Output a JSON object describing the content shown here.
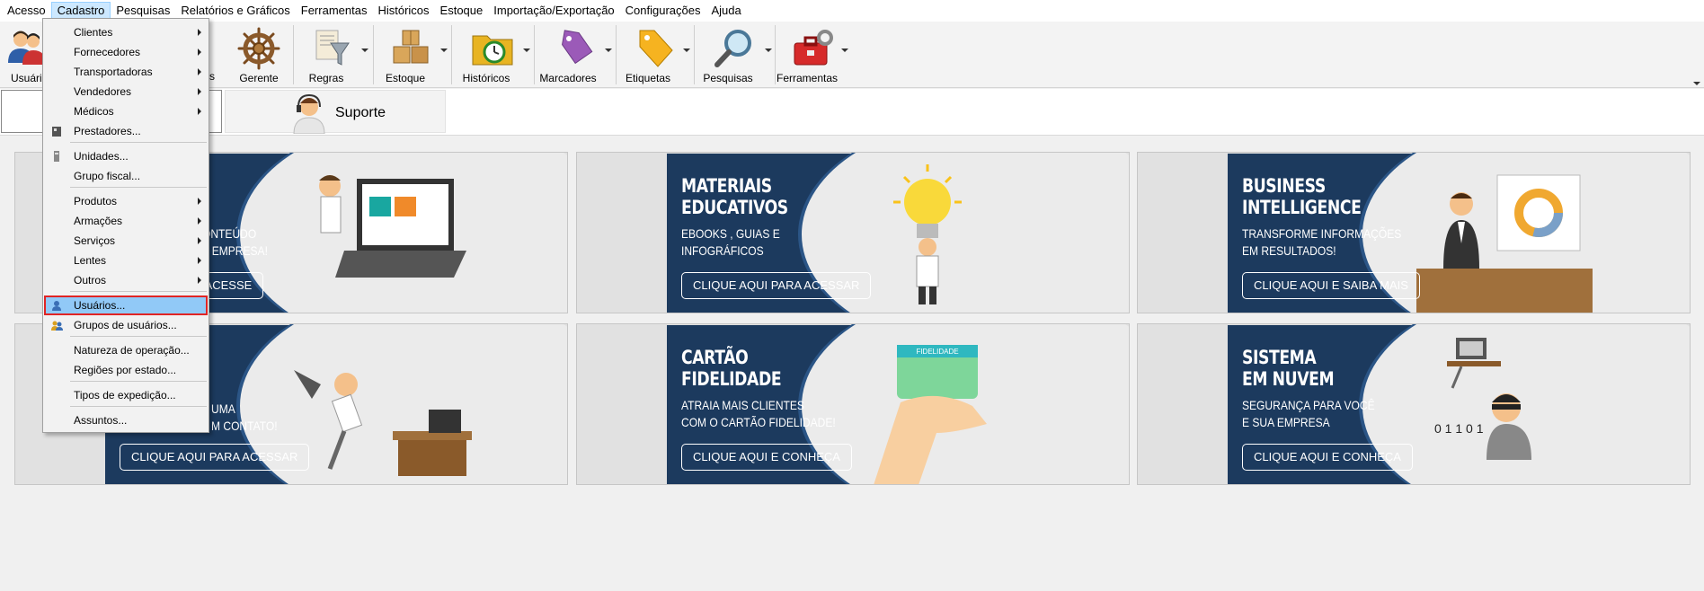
{
  "menubar": [
    "Acesso",
    "Cadastro",
    "Pesquisas",
    "Relatórios e Gráficos",
    "Ferramentas",
    "Históricos",
    "Estoque",
    "Importação/Exportação",
    "Configurações",
    "Ajuda"
  ],
  "toolbar": {
    "usuarios": "Usuári",
    "hidden_s": "s",
    "gerente": "Gerente",
    "regras": "Regras",
    "estoque": "Estoque",
    "historicos": "Históricos",
    "marcadores": "Marcadores",
    "etiquetas": "Etiquetas",
    "pesquisas": "Pesquisas",
    "ferramentas": "Ferramentas"
  },
  "tabs": {
    "suporte": "Suporte"
  },
  "cadastro_menu": {
    "clientes": "Clientes",
    "fornecedores": "Fornecedores",
    "transportadoras": "Transportadoras",
    "vendedores": "Vendedores",
    "medicos": "Médicos",
    "prestadores": "Prestadores...",
    "unidades": "Unidades...",
    "grupo_fiscal": "Grupo fiscal...",
    "produtos": "Produtos",
    "armacoes": "Armações",
    "servicos": "Serviços",
    "lentes": "Lentes",
    "outros": "Outros",
    "usuarios": "Usuários...",
    "grupos_usuarios": "Grupos de usuários...",
    "natureza": "Natureza de operação...",
    "regioes": "Regiões por estado...",
    "tipos_expedicao": "Tipos de expedição...",
    "assuntos": "Assuntos..."
  },
  "cards": {
    "c1": {
      "t2a": "ONTEÚDO",
      "t2b": "A EMPRESA!",
      "cta": "E ACESSE"
    },
    "c2": {
      "t1a": "MATERIAIS",
      "t1b": "EDUCATIVOS",
      "t2a": "EBOOKS , GUIAS E",
      "t2b": "INFOGRÁFICOS",
      "cta": "CLIQUE AQUI PARA ACESSAR"
    },
    "c3": {
      "t1a": "BUSINESS",
      "t1b": "INTELLIGENCE",
      "t2a": "TRANSFORME INFORMAÇÕES",
      "t2b": "EM RESULTADOS!",
      "cta": "CLIQUE AQUI E SAIBA MAIS"
    },
    "c4": {
      "t2a": "UMA",
      "t2b": "M CONTATO!",
      "cta": "CLIQUE AQUI PARA ACESSAR"
    },
    "c5": {
      "t1a": "CARTÃO",
      "t1b": "FIDELIDADE",
      "t2a": "ATRAIA MAIS CLIENTES",
      "t2b": "COM O CARTÃO FIDELIDADE!",
      "cta": "CLIQUE AQUI E CONHEÇA",
      "card_label": "FIDELIDADE"
    },
    "c6": {
      "t1a": "SISTEMA",
      "t1b": "EM NUVEM",
      "t2a": "SEGURANÇA PARA VOCÊ",
      "t2b": "E SUA EMPRESA",
      "cta": "CLIQUE AQUI E CONHEÇA",
      "digits": "0 1 1 0 1"
    }
  }
}
